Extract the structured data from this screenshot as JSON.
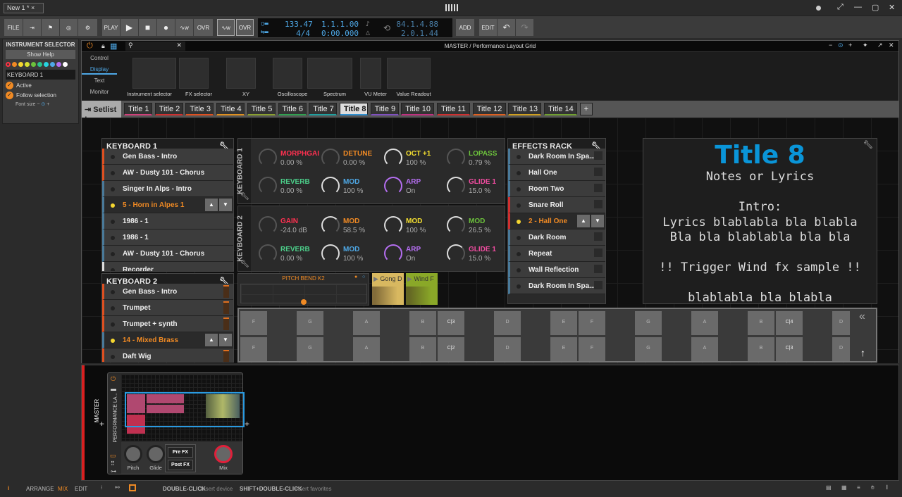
{
  "topbar": {
    "tab": "New 1 *",
    "tab_close": "×",
    "win": {
      "fullscreen": "⤢",
      "minimize": "—",
      "maximize": "▢",
      "close": "✕"
    }
  },
  "toolbar": {
    "file": "FILE",
    "play_menu": "PLAY",
    "ovr1": "OVR",
    "ovr2": "OVR",
    "add": "ADD",
    "edit": "EDIT",
    "tempo": "133.47",
    "signature": "4/4",
    "position": "1.1.1.00",
    "time": "0:00.000",
    "loop_start": "84.1.4.88",
    "loop_length": "2.0.1.44"
  },
  "left": {
    "title": "INSTRUMENT SELECTOR",
    "help": "Show Help",
    "colors": [
      "#ff3344",
      "#f08a24",
      "#f5d630",
      "#d8e030",
      "#6cc23c",
      "#2cc28a",
      "#27d3e0",
      "#4ea8e6",
      "#b46ef0",
      "#ffffff"
    ],
    "name": "KEYBOARD 1",
    "active": "Active",
    "follow": "Follow selection",
    "font_size": "Font size"
  },
  "window": {
    "title": "MASTER / Performance Layout Grid",
    "categories": [
      "Control",
      "Display",
      "Text",
      "Monitor"
    ],
    "active_category": "Display",
    "palette": [
      "Instrument selector",
      "FX selector",
      "XY",
      "Oscilloscope",
      "Spectrum",
      "VU Meter",
      "Value Readout"
    ]
  },
  "setlist": {
    "label": "Setlist :",
    "add": "+",
    "selected": 7,
    "tabs": [
      {
        "label": "Title  1",
        "color": "#d0407a"
      },
      {
        "label": "Title  2",
        "color": "#d03030"
      },
      {
        "label": "Title  3",
        "color": "#e05020"
      },
      {
        "label": "Title  4",
        "color": "#e09020"
      },
      {
        "label": "Title  5",
        "color": "#8aa030"
      },
      {
        "label": "Title  6",
        "color": "#30a050"
      },
      {
        "label": "Title  7",
        "color": "#20a0a0"
      },
      {
        "label": "Title  8",
        "color": "#3090d0"
      },
      {
        "label": "Title  9",
        "color": "#8050c0"
      },
      {
        "label": "Title  10",
        "color": "#c03080"
      },
      {
        "label": "Title  11",
        "color": "#d03030"
      },
      {
        "label": "Title  12",
        "color": "#e06020"
      },
      {
        "label": "Title  13",
        "color": "#d0a020"
      },
      {
        "label": "Title  14",
        "color": "#70a030"
      }
    ]
  },
  "keyboard1": {
    "title": "KEYBOARD 1",
    "items": [
      {
        "label": "Gen Bass - Intro",
        "color": "#e05020"
      },
      {
        "label": "AW - Dusty 101 - Chorus",
        "color": "#e05020"
      },
      {
        "label": "Singer In Alps - Intro",
        "color": "#4a7a9a"
      },
      {
        "label": "5 - Horn in Alpes 1",
        "color": "#4a7a9a",
        "selected": true
      },
      {
        "label": "1986 - 1",
        "color": "#4a7a9a"
      },
      {
        "label": "1986 - 1",
        "color": "#4a7a9a"
      },
      {
        "label": "AW - Dusty 101 - Chorus",
        "color": "#4a7a9a"
      },
      {
        "label": "Recorder",
        "color": "#ddd"
      }
    ]
  },
  "keyboard2": {
    "title": "KEYBOARD 2",
    "items": [
      {
        "label": "Gen Bass - Intro",
        "color": "#e05020"
      },
      {
        "label": "Trumpet",
        "color": "#e05020"
      },
      {
        "label": "Trumpet + synth",
        "color": "#e05020"
      },
      {
        "label": "14 - Mixed Brass",
        "color": "#4a7a9a",
        "selected": true
      },
      {
        "label": "Daft Wig",
        "color": "#e05020"
      }
    ]
  },
  "knobs1": {
    "title": "KEYBOARD 1",
    "knobs": [
      {
        "label": "MORPHGAI",
        "value": "0.00 %",
        "color": "#ff3050",
        "level": 0
      },
      {
        "label": "DETUNE",
        "value": "0.00 %",
        "color": "#f08a24",
        "level": 0
      },
      {
        "label": "OCT +1",
        "value": "100 %",
        "color": "#f5e030",
        "level": 1
      },
      {
        "label": "LOPASS",
        "value": "0.79 %",
        "color": "#6cc23c",
        "level": 0.01
      },
      {
        "label": "REVERB",
        "value": "0.00 %",
        "color": "#4ccf8a",
        "level": 0
      },
      {
        "label": "MOD",
        "value": "100 %",
        "color": "#4ea8e6",
        "level": 1
      },
      {
        "label": "ARP",
        "value": "On",
        "color": "#b46ef0",
        "level": 1
      },
      {
        "label": "GLIDE 1",
        "value": "15.0 %",
        "color": "#f04ca0",
        "level": 0.15
      }
    ]
  },
  "knobs2": {
    "title": "KEYBOARD 2",
    "knobs": [
      {
        "label": "GAIN",
        "value": "-24.0 dB",
        "color": "#ff3050",
        "level": 0
      },
      {
        "label": "MOD",
        "value": "58.5 %",
        "color": "#f08a24",
        "level": 0.585
      },
      {
        "label": "MOD",
        "value": "100 %",
        "color": "#f5e030",
        "level": 1
      },
      {
        "label": "MOD",
        "value": "26.5 %",
        "color": "#6cc23c",
        "level": 0.265
      },
      {
        "label": "REVERB",
        "value": "0.00 %",
        "color": "#4ccf8a",
        "level": 0
      },
      {
        "label": "MOD",
        "value": "100 %",
        "color": "#4ea8e6",
        "level": 1
      },
      {
        "label": "ARP",
        "value": "On",
        "color": "#b46ef0",
        "level": 1
      },
      {
        "label": "GLIDE 1",
        "value": "15.0 %",
        "color": "#f04ca0",
        "level": 0.15
      }
    ]
  },
  "pitchbend": {
    "title": "PITCH BEND K2",
    "value": 0.5
  },
  "clips": [
    {
      "label": "Gong D",
      "color": "#d8b860"
    },
    {
      "label": "Wind F",
      "color": "#8aa828"
    }
  ],
  "effects": {
    "title": "EFFECTS RACK",
    "items": [
      {
        "label": "Dark Room In Spa...",
        "color": "#4a7a9a"
      },
      {
        "label": "Hall One",
        "color": "#4a7a9a"
      },
      {
        "label": "Room Two",
        "color": "#4a7a9a"
      },
      {
        "label": "Snare Roll",
        "color": "#d03030"
      },
      {
        "label": "2 - Hall One",
        "color": "#d03030",
        "selected": true
      },
      {
        "label": "Dark Room",
        "color": "#4a7a9a"
      },
      {
        "label": "Repeat",
        "color": "#4a7a9a"
      },
      {
        "label": "Wall Reflection",
        "color": "#4a7a9a"
      },
      {
        "label": "Dark Room In Spa...",
        "color": "#4a7a9a"
      }
    ]
  },
  "lyrics": {
    "title": "Title 8",
    "lines": [
      "Notes or Lyrics",
      "",
      "Intro:",
      "Lyrics blablabla bla blabla",
      "Bla bla blablabla bla bla",
      "",
      "!! Trigger Wind fx sample !!",
      "",
      "blablabla bla blabla"
    ]
  },
  "piano": {
    "rows": [
      [
        "F",
        "",
        "G",
        "",
        "A",
        "",
        "B",
        "C|3",
        "",
        "D",
        "",
        "E",
        "F",
        "",
        "G",
        "",
        "A",
        "",
        "B",
        "C|4",
        "",
        "D"
      ],
      [
        "F",
        "",
        "G",
        "",
        "A",
        "",
        "B",
        "C|2",
        "",
        "D",
        "",
        "E",
        "F",
        "",
        "G",
        "",
        "A",
        "",
        "B",
        "C|3",
        "",
        "D"
      ]
    ],
    "collapse": "«",
    "up": "↑"
  },
  "device": {
    "track": "MASTER",
    "name": "PERFORMANCE LA...",
    "knobs": [
      "Pitch",
      "Glide",
      "Mix"
    ],
    "pre_fx": "Pre FX",
    "post_fx": "Post FX",
    "add": "+"
  },
  "status": {
    "arrange": "ARRANGE",
    "mix": "MIX",
    "edit": "EDIT",
    "hint1_key": "DOUBLE-CLICK",
    "hint1": "Insert device",
    "hint2_key": "SHIFT+DOUBLE-CLICK",
    "hint2": "Insert favorites"
  }
}
